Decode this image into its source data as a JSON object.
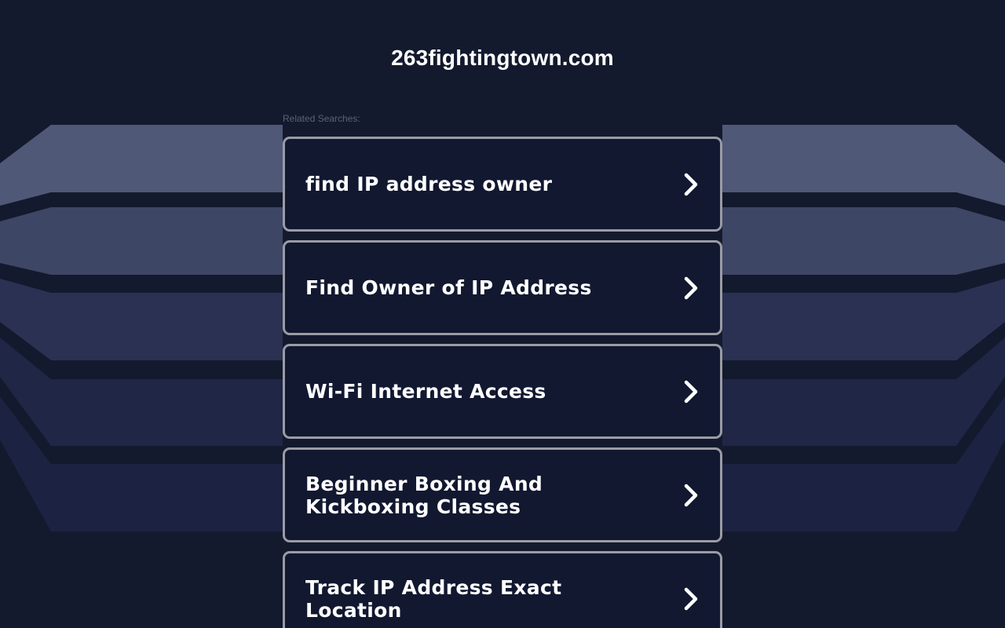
{
  "header": {
    "domain": "263fightingtown.com"
  },
  "related": {
    "label": "Related Searches:"
  },
  "links": [
    {
      "label": "find IP address owner",
      "icon": "chevron-right-icon"
    },
    {
      "label": "Find Owner of IP Address",
      "icon": "chevron-right-icon"
    },
    {
      "label": "Wi-Fi Internet Access",
      "icon": "chevron-right-icon"
    },
    {
      "label": "Beginner Boxing And Kickboxing Classes",
      "icon": "chevron-right-icon"
    },
    {
      "label": "Track IP Address Exact Location",
      "icon": "chevron-right-icon"
    }
  ],
  "colors": {
    "background": "#131a2e",
    "card_background": "#121830",
    "card_border": "#9a9ca4",
    "text": "#ffffff",
    "muted_text": "#59617a"
  }
}
